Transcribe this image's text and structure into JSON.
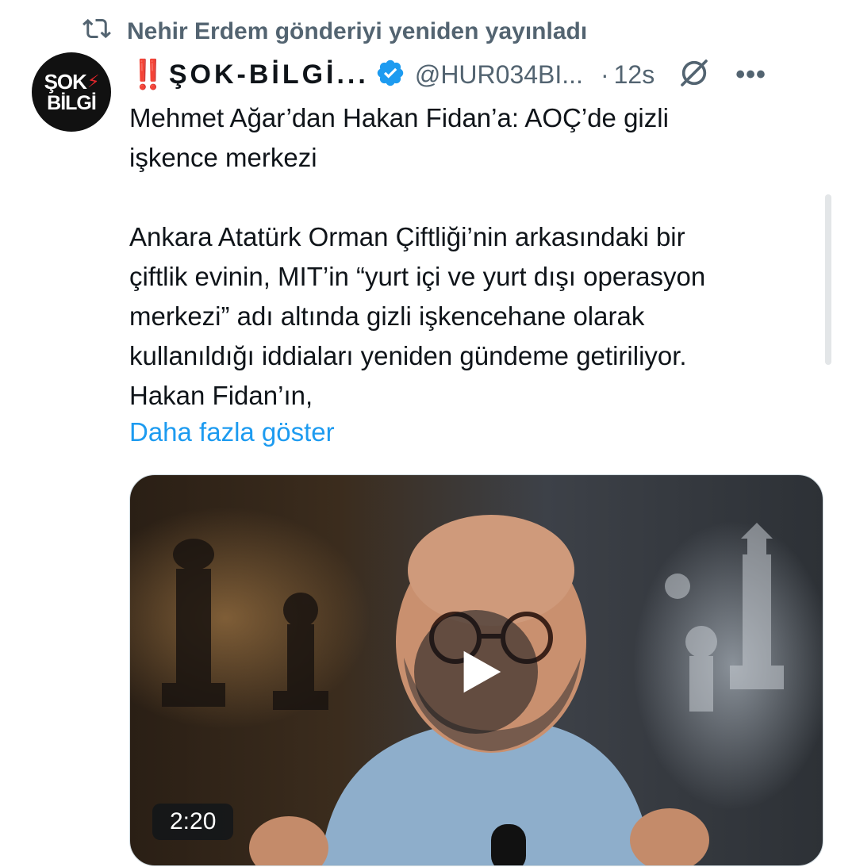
{
  "repost": {
    "icon": "repost-icon",
    "text": "Nehir Erdem gönderiyi yeniden yayınladı"
  },
  "author": {
    "avatar_line1": "ŞOK",
    "avatar_line2": "BİLGİ",
    "name_prefix": "‼️",
    "display_name": "ŞOK-BİLGİ...",
    "verified_icon": "verified-badge-icon",
    "handle": "@HUR034BI...",
    "separator": "·",
    "time": "12s"
  },
  "tweet": {
    "line1": "Mehmet Ağar’dan Hakan Fidan’a: AOÇ’de gizli",
    "line2": "işkence merkezi",
    "para1": "Ankara Atatürk Orman Çiftliği’nin arkasındaki bir",
    "para2": "çiftlik evinin, MIT’in “yurt içi ve yurt dışı operasyon",
    "para3": "merkezi” adı altında gizli işkencehane olarak",
    "para4": "kullanıldığı iddiaları yeniden gündeme getiriliyor.",
    "para5": "Hakan Fidan’ın,",
    "show_more": "Daha fazla göster"
  },
  "media": {
    "type": "video",
    "duration": "2:20",
    "play_icon": "play-icon"
  },
  "actions": {
    "grok_icon": "grok-icon",
    "more_icon": "more-icon",
    "more_label": "•••"
  },
  "colors": {
    "accent": "#1d9bf0",
    "secondary_text": "#536471",
    "alert_red": "#e0262b"
  }
}
